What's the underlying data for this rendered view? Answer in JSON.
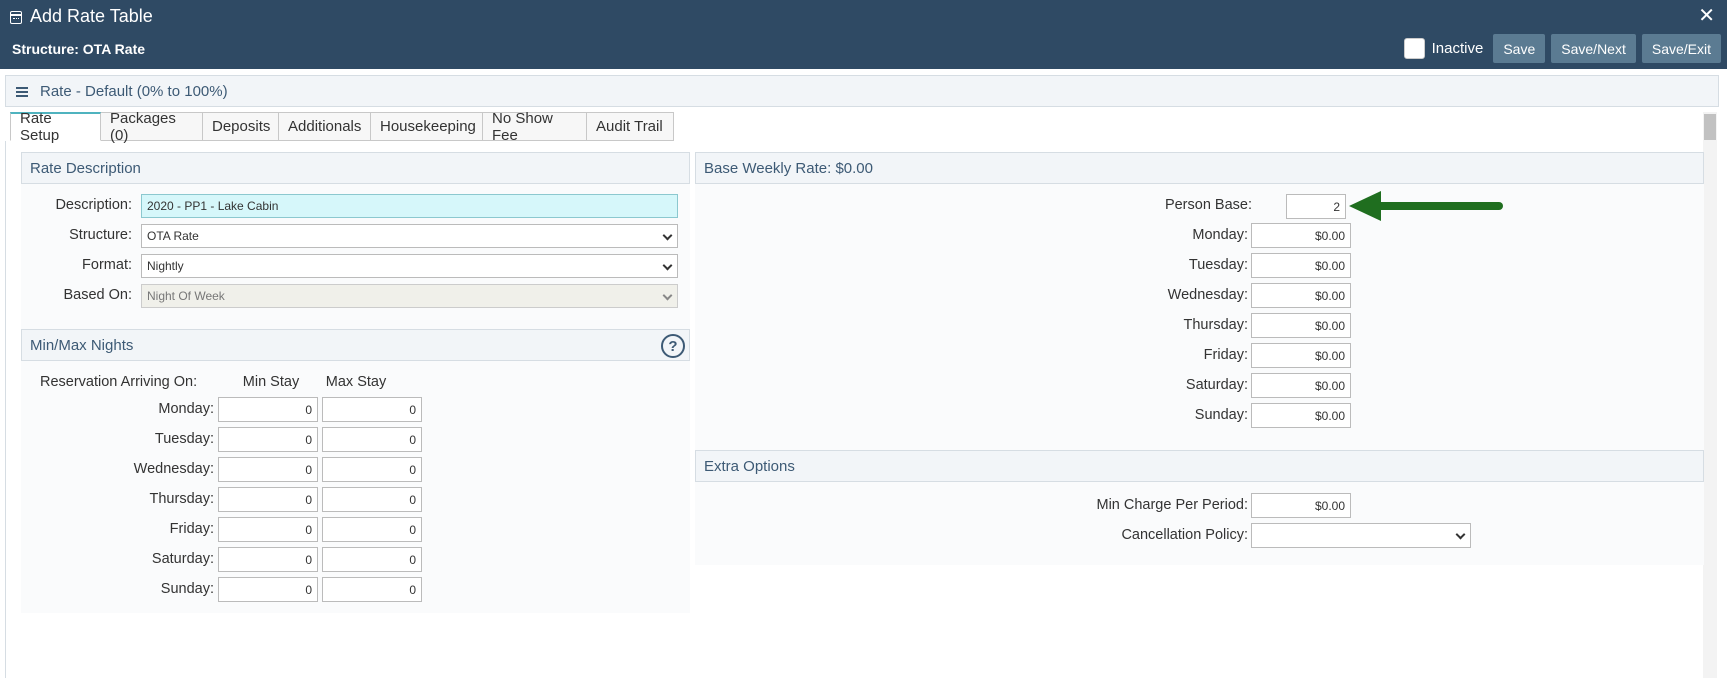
{
  "header": {
    "title": "Add Rate Table",
    "structure": "Structure: OTA Rate",
    "close": "✕",
    "inactive_label": "Inactive",
    "save": "Save",
    "save_next": "Save/Next",
    "save_exit": "Save/Exit"
  },
  "rate_bar": {
    "title": "Rate - Default (0% to 100%)"
  },
  "tabs": [
    {
      "label": "Rate Setup",
      "active": true
    },
    {
      "label": "Packages (0)"
    },
    {
      "label": "Deposits"
    },
    {
      "label": "Additionals"
    },
    {
      "label": "Housekeeping"
    },
    {
      "label": "No Show Fee"
    },
    {
      "label": "Audit Trail"
    }
  ],
  "rate_description": {
    "heading": "Rate Description",
    "description_label": "Description:",
    "description_value": "2020 - PP1 - Lake Cabin",
    "structure_label": "Structure:",
    "structure_value": "OTA Rate",
    "format_label": "Format:",
    "format_value": "Nightly",
    "based_on_label": "Based On:",
    "based_on_value": "Night Of Week"
  },
  "min_max": {
    "heading": "Min/Max Nights",
    "help": "?",
    "arriving_label": "Reservation Arriving On:",
    "min_header": "Min Stay",
    "max_header": "Max Stay",
    "rows": [
      {
        "day": "Monday:",
        "min": "0",
        "max": "0"
      },
      {
        "day": "Tuesday:",
        "min": "0",
        "max": "0"
      },
      {
        "day": "Wednesday:",
        "min": "0",
        "max": "0"
      },
      {
        "day": "Thursday:",
        "min": "0",
        "max": "0"
      },
      {
        "day": "Friday:",
        "min": "0",
        "max": "0"
      },
      {
        "day": "Saturday:",
        "min": "0",
        "max": "0"
      },
      {
        "day": "Sunday:",
        "min": "0",
        "max": "0"
      }
    ]
  },
  "base_weekly": {
    "heading": "Base Weekly Rate: $0.00",
    "person_base_label": "Person Base:",
    "person_base_value": "2",
    "rows": [
      {
        "day": "Monday:",
        "value": "$0.00"
      },
      {
        "day": "Tuesday:",
        "value": "$0.00"
      },
      {
        "day": "Wednesday:",
        "value": "$0.00"
      },
      {
        "day": "Thursday:",
        "value": "$0.00"
      },
      {
        "day": "Friday:",
        "value": "$0.00"
      },
      {
        "day": "Saturday:",
        "value": "$0.00"
      },
      {
        "day": "Sunday:",
        "value": "$0.00"
      }
    ]
  },
  "extra_options": {
    "heading": "Extra Options",
    "min_charge_label": "Min Charge Per Period:",
    "min_charge_value": "$0.00",
    "cancellation_label": "Cancellation Policy:",
    "cancellation_value": ""
  },
  "colors": {
    "header_bg": "#2f4a64",
    "button_bg": "#5b7b92",
    "accent_tab": "#4fb3bf",
    "arrow_green": "#1f6e1f"
  }
}
